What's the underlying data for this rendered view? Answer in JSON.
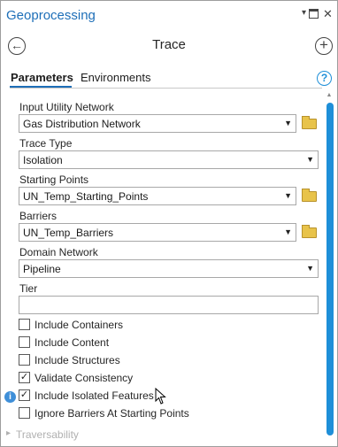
{
  "window": {
    "title": "Geoprocessing"
  },
  "tool": {
    "title": "Trace"
  },
  "tabs": [
    {
      "label": "Parameters",
      "active": true
    },
    {
      "label": "Environments",
      "active": false
    }
  ],
  "fields": {
    "input_utility_network": {
      "label": "Input Utility Network",
      "value": "Gas Distribution Network"
    },
    "trace_type": {
      "label": "Trace Type",
      "value": "Isolation"
    },
    "starting_points": {
      "label": "Starting Points",
      "value": "UN_Temp_Starting_Points"
    },
    "barriers": {
      "label": "Barriers",
      "value": "UN_Temp_Barriers"
    },
    "domain_network": {
      "label": "Domain Network",
      "value": "Pipeline"
    },
    "tier": {
      "label": "Tier",
      "value": ""
    }
  },
  "checkboxes": [
    {
      "label": "Include Containers",
      "checked": false,
      "mark": ""
    },
    {
      "label": "Include Content",
      "checked": false,
      "mark": ""
    },
    {
      "label": "Include Structures",
      "checked": false,
      "mark": ""
    },
    {
      "label": "Validate Consistency",
      "checked": true,
      "mark": "✓"
    },
    {
      "label": "Include Isolated Features",
      "checked": true,
      "mark": "✓"
    },
    {
      "label": "Ignore Barriers At Starting Points",
      "checked": false,
      "mark": ""
    }
  ],
  "sections": {
    "traversability": "Traversability"
  },
  "icons": {
    "dropdown": "▾",
    "restore": "restore-icon",
    "close": "✕",
    "back": "←",
    "add": "+",
    "help": "?",
    "info": "i",
    "combo_arrow": "▼",
    "expand": "▸",
    "scroll_up": "▲"
  },
  "colors": {
    "accent": "#1e6fb8",
    "scrollbar": "#1e8fd8",
    "folder": "#e8c34a"
  }
}
